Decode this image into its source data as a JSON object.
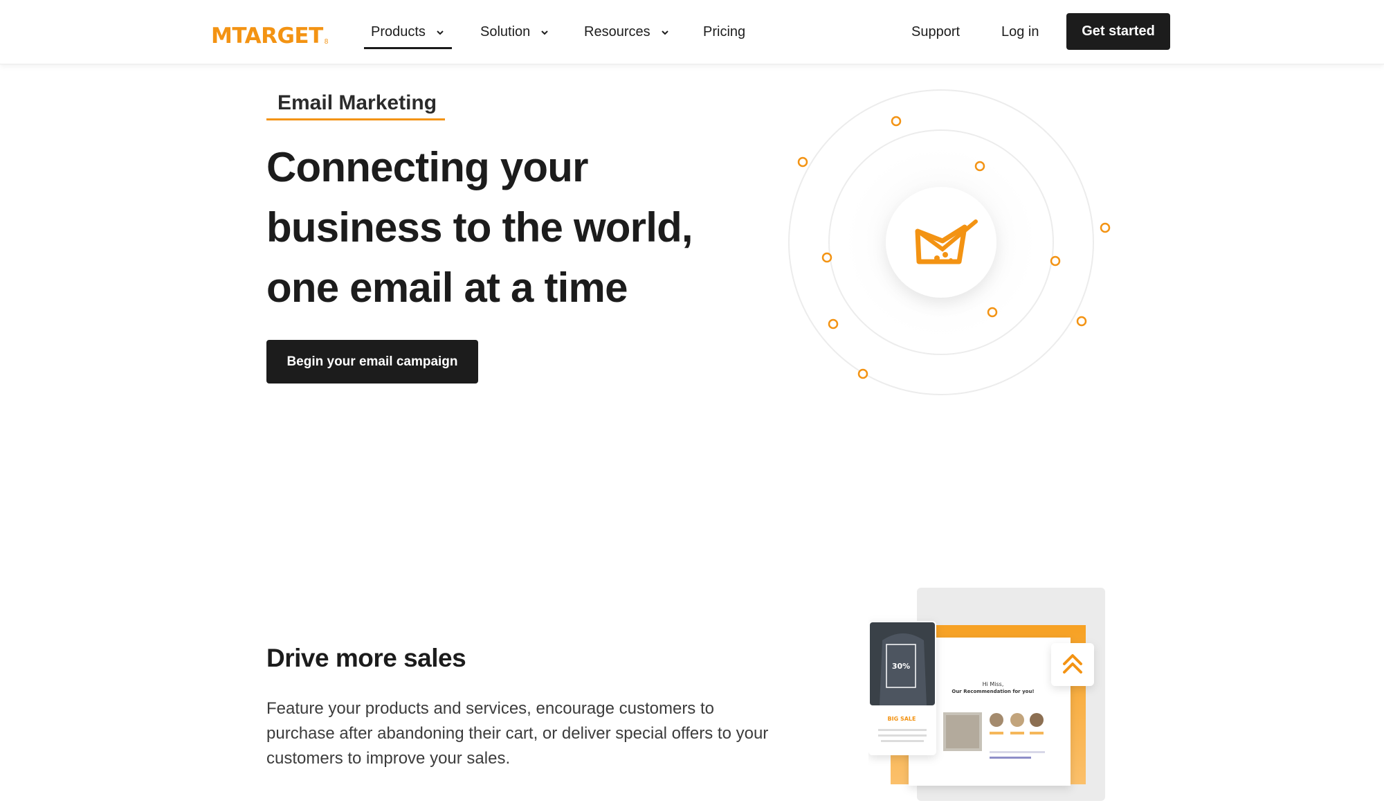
{
  "header": {
    "logo_text": "MTARGET",
    "logo_sub": "8",
    "nav": [
      {
        "label": "Products",
        "has_dropdown": true,
        "active": true
      },
      {
        "label": "Solution",
        "has_dropdown": true,
        "active": false
      },
      {
        "label": "Resources",
        "has_dropdown": true,
        "active": false
      },
      {
        "label": "Pricing",
        "has_dropdown": false,
        "active": false
      }
    ],
    "support_label": "Support",
    "login_label": "Log in",
    "cta_label": "Get started"
  },
  "hero": {
    "eyebrow": "Email Marketing",
    "title_lines": [
      "Connecting your",
      "business to the world,",
      "one email at a time"
    ],
    "button_label": "Begin your email campaign",
    "icon": "email-send-icon"
  },
  "section": {
    "title": "Drive more sales",
    "body": "Feature your products and services, encourage customers to purchase after abandoning their cart, or deliver special offers to your customers to improve your sales."
  },
  "promo": {
    "badge": "30%",
    "sale_label": "BIG SALE",
    "greeting_line1": "Hi Miss,",
    "greeting_line2": "Our Recommendation for you!",
    "icon": "double-chevron-up-icon"
  },
  "colors": {
    "accent": "#f39313",
    "dark": "#1c1c1c",
    "text": "#3c3c3c"
  }
}
